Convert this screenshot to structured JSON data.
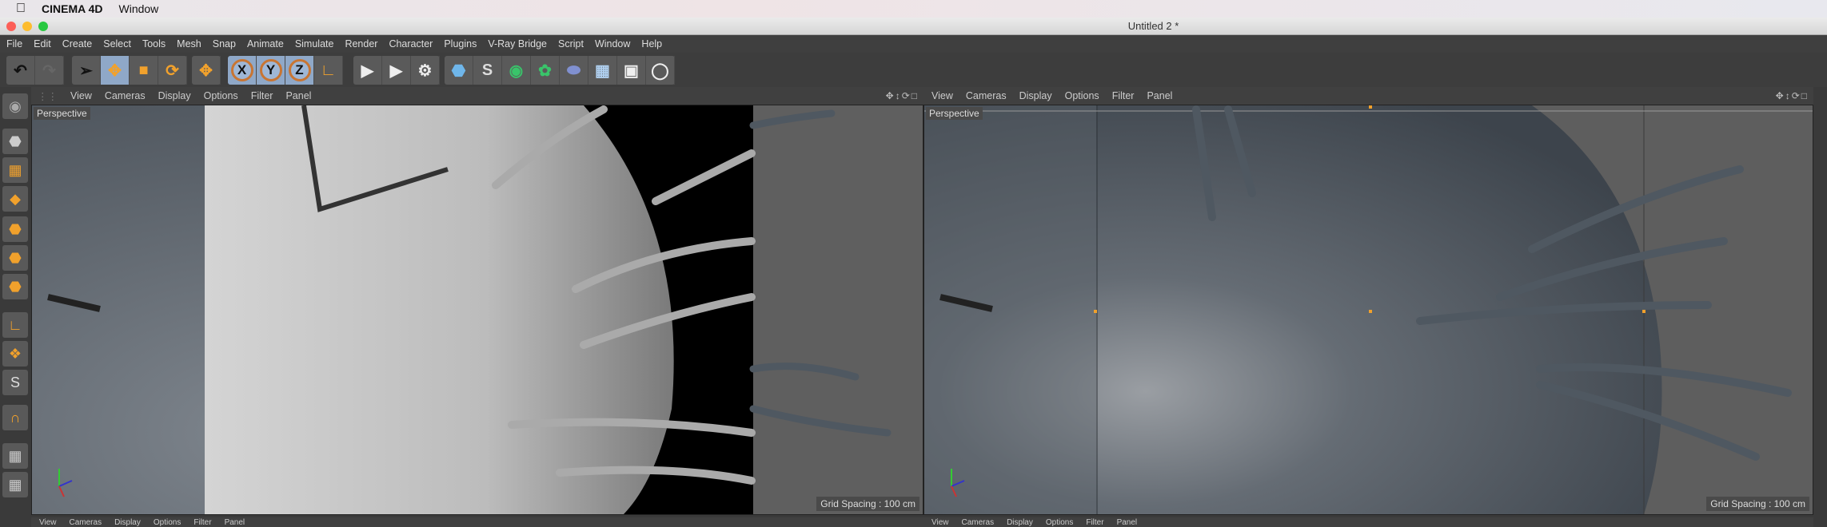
{
  "mac_menu": {
    "app": "CINEMA 4D",
    "window": "Window"
  },
  "window_title": "Untitled 2 *",
  "menu": [
    "File",
    "Edit",
    "Create",
    "Select",
    "Tools",
    "Mesh",
    "Snap",
    "Animate",
    "Simulate",
    "Render",
    "Character",
    "Plugins",
    "V-Ray Bridge",
    "Script",
    "Window",
    "Help"
  ],
  "toolbar": {
    "axes": [
      "X",
      "Y",
      "Z"
    ]
  },
  "viewport_menu": [
    "View",
    "Cameras",
    "Display",
    "Options",
    "Filter",
    "Panel"
  ],
  "viewports": [
    {
      "label": "Perspective",
      "grid": "Grid Spacing : 100 cm"
    },
    {
      "label": "Perspective",
      "grid": "Grid Spacing : 100 cm"
    }
  ],
  "colors": {
    "accent": "#f1a12c",
    "selected": "#8fa8c8"
  }
}
